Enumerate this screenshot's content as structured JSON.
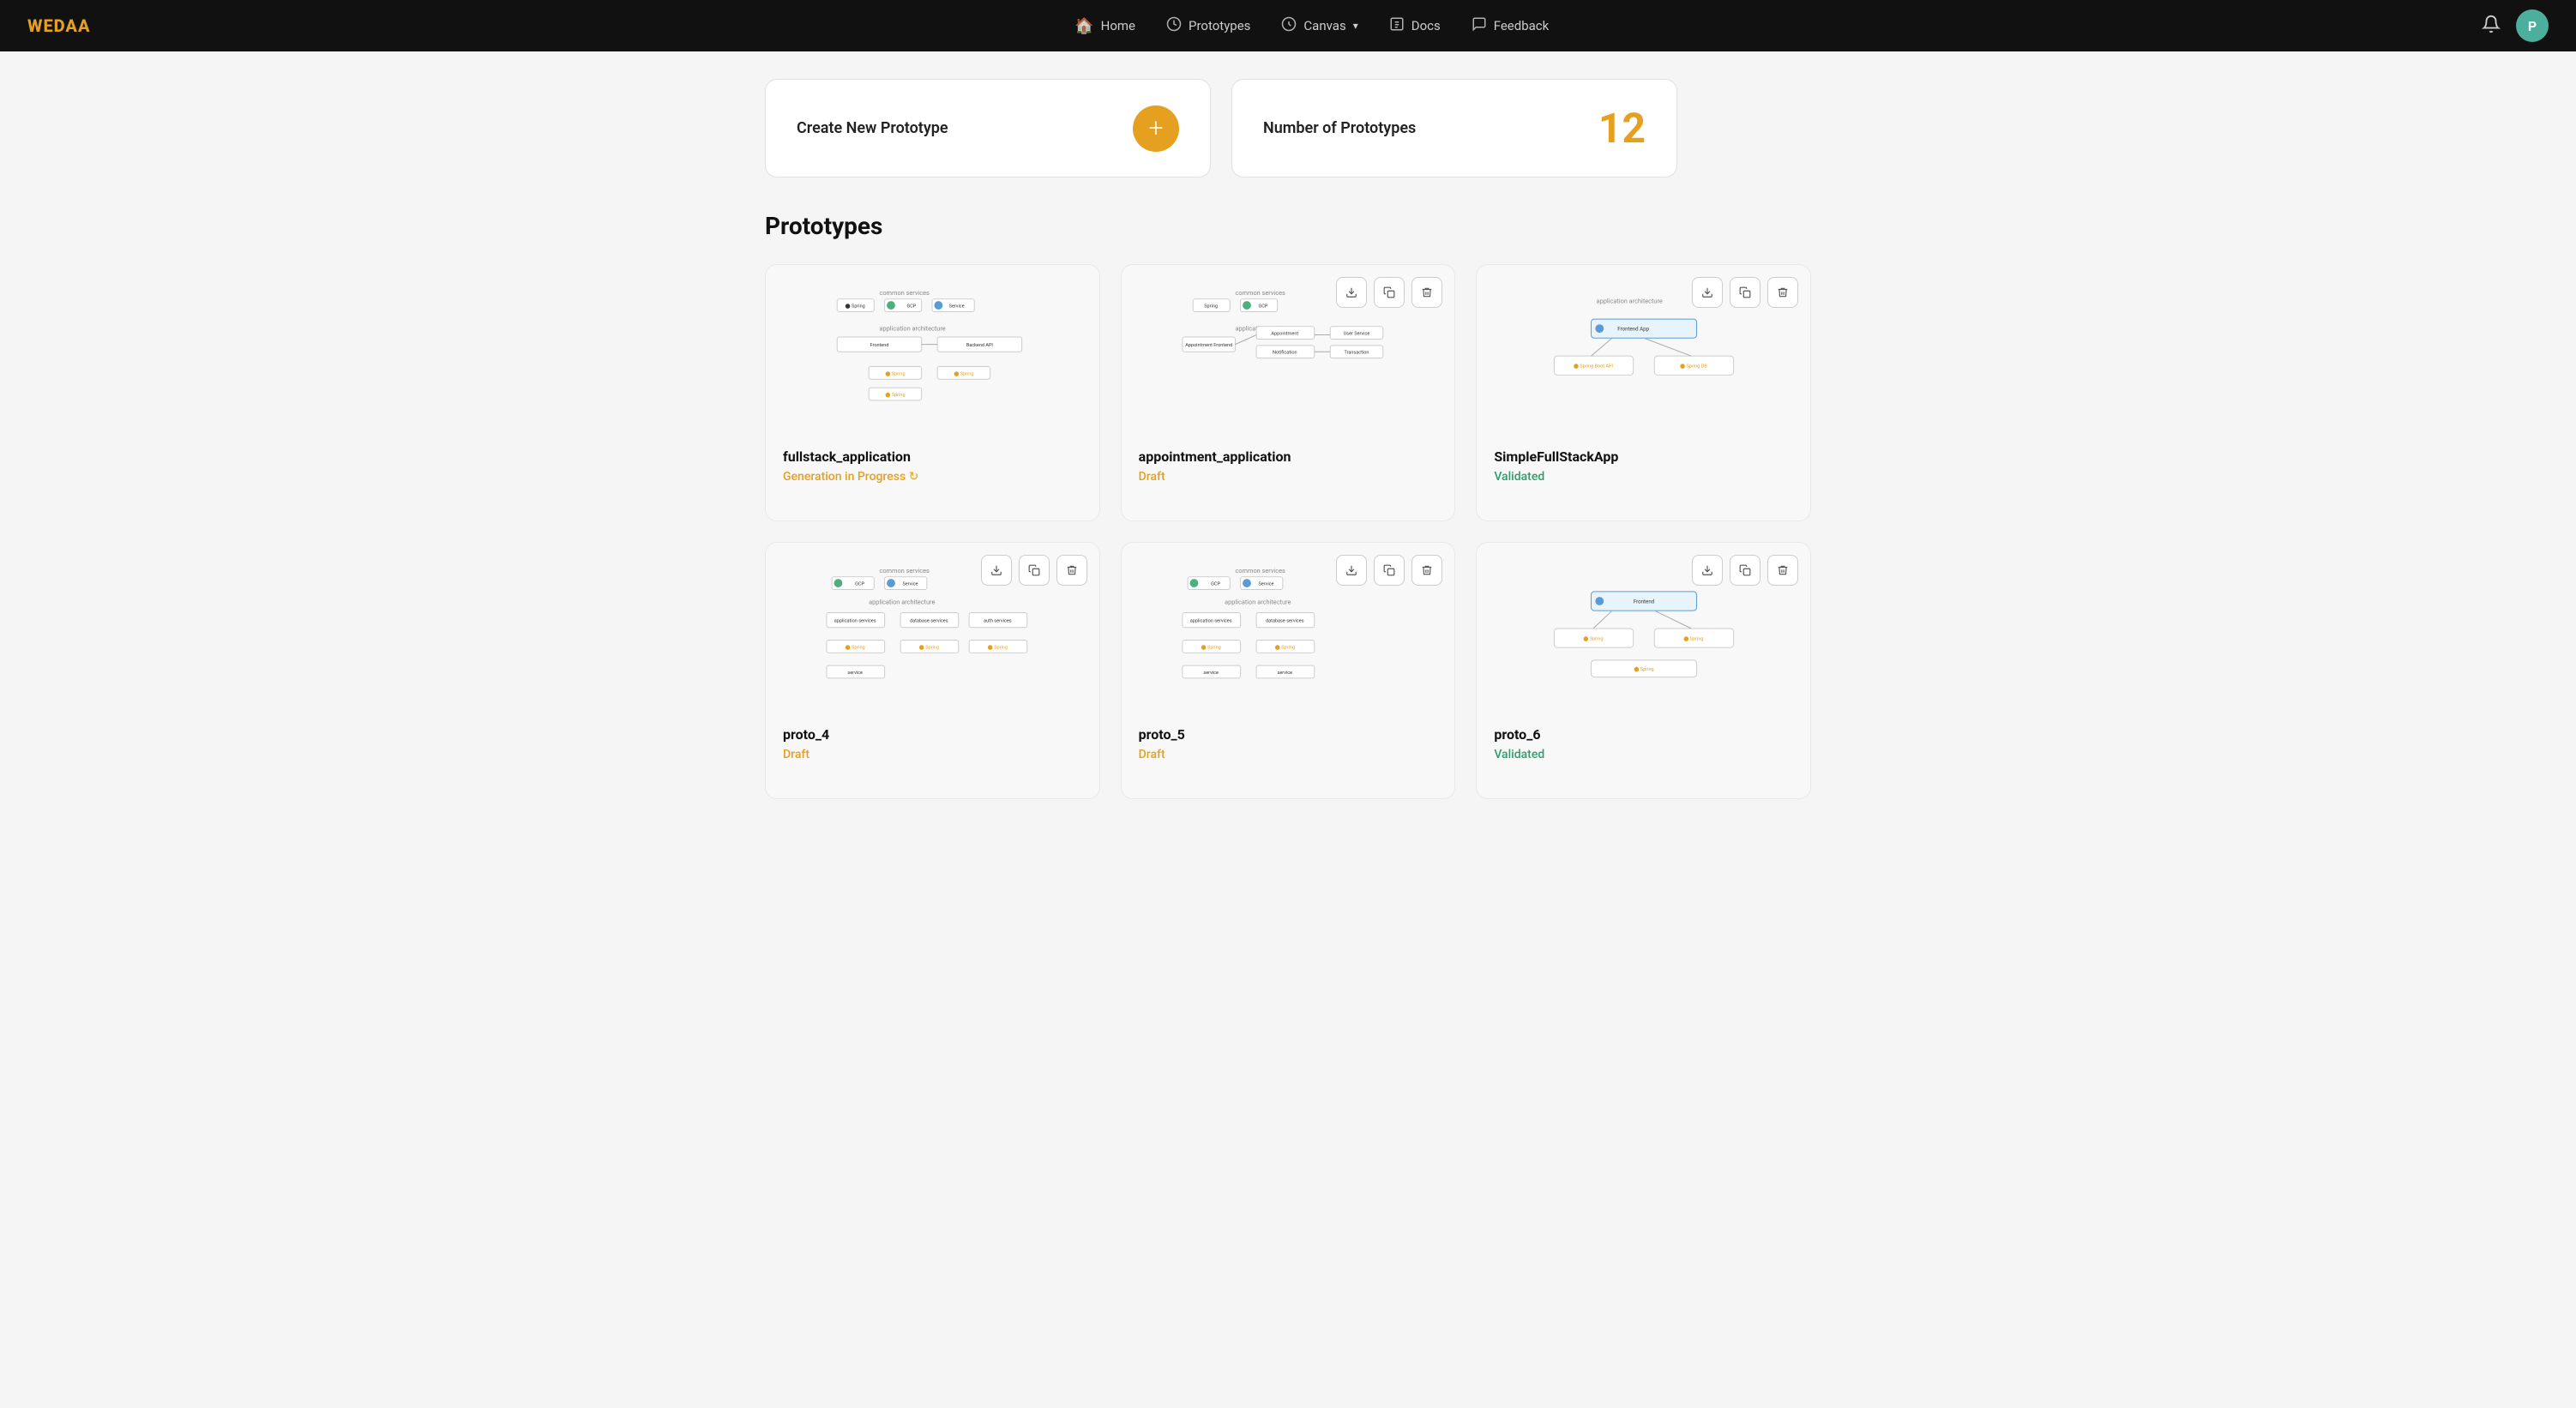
{
  "logo": {
    "text_we": "WE",
    "text_daa": "DAA"
  },
  "nav": {
    "links": [
      {
        "id": "home",
        "label": "Home",
        "icon": "🏠"
      },
      {
        "id": "prototypes",
        "label": "Prototypes",
        "icon": "🔄"
      },
      {
        "id": "canvas",
        "label": "Canvas",
        "icon": "⏱",
        "has_chevron": true
      },
      {
        "id": "docs",
        "label": "Docs",
        "icon": "📦"
      },
      {
        "id": "feedback",
        "label": "Feedback",
        "icon": "💬"
      }
    ],
    "avatar_letter": "P",
    "bell_icon": "🔔"
  },
  "top_cards": {
    "create": {
      "label": "Create New Prototype",
      "btn_icon": "+"
    },
    "count": {
      "label": "Number of Prototypes",
      "number": "12"
    }
  },
  "section_title": "Prototypes",
  "action_buttons": {
    "download": "⬇",
    "copy": "⧉",
    "delete": "🗑"
  },
  "prototypes": [
    {
      "id": "fullstack_application",
      "name": "fullstack_application",
      "status": "Generation in Progress ↻",
      "status_class": "status-progress",
      "show_actions": false
    },
    {
      "id": "appointment_application",
      "name": "appointment_application",
      "status": "Draft",
      "status_class": "status-draft",
      "show_actions": true
    },
    {
      "id": "SimpleFullStackApp",
      "name": "SimpleFullStackApp",
      "status": "Validated",
      "status_class": "status-validated",
      "show_actions": true
    },
    {
      "id": "proto_4",
      "name": "proto_4",
      "status": "Draft",
      "status_class": "status-draft",
      "show_actions": true
    },
    {
      "id": "proto_5",
      "name": "proto_5",
      "status": "Draft",
      "status_class": "status-draft",
      "show_actions": true
    },
    {
      "id": "proto_6",
      "name": "proto_6",
      "status": "Validated",
      "status_class": "status-validated",
      "show_actions": true
    }
  ]
}
